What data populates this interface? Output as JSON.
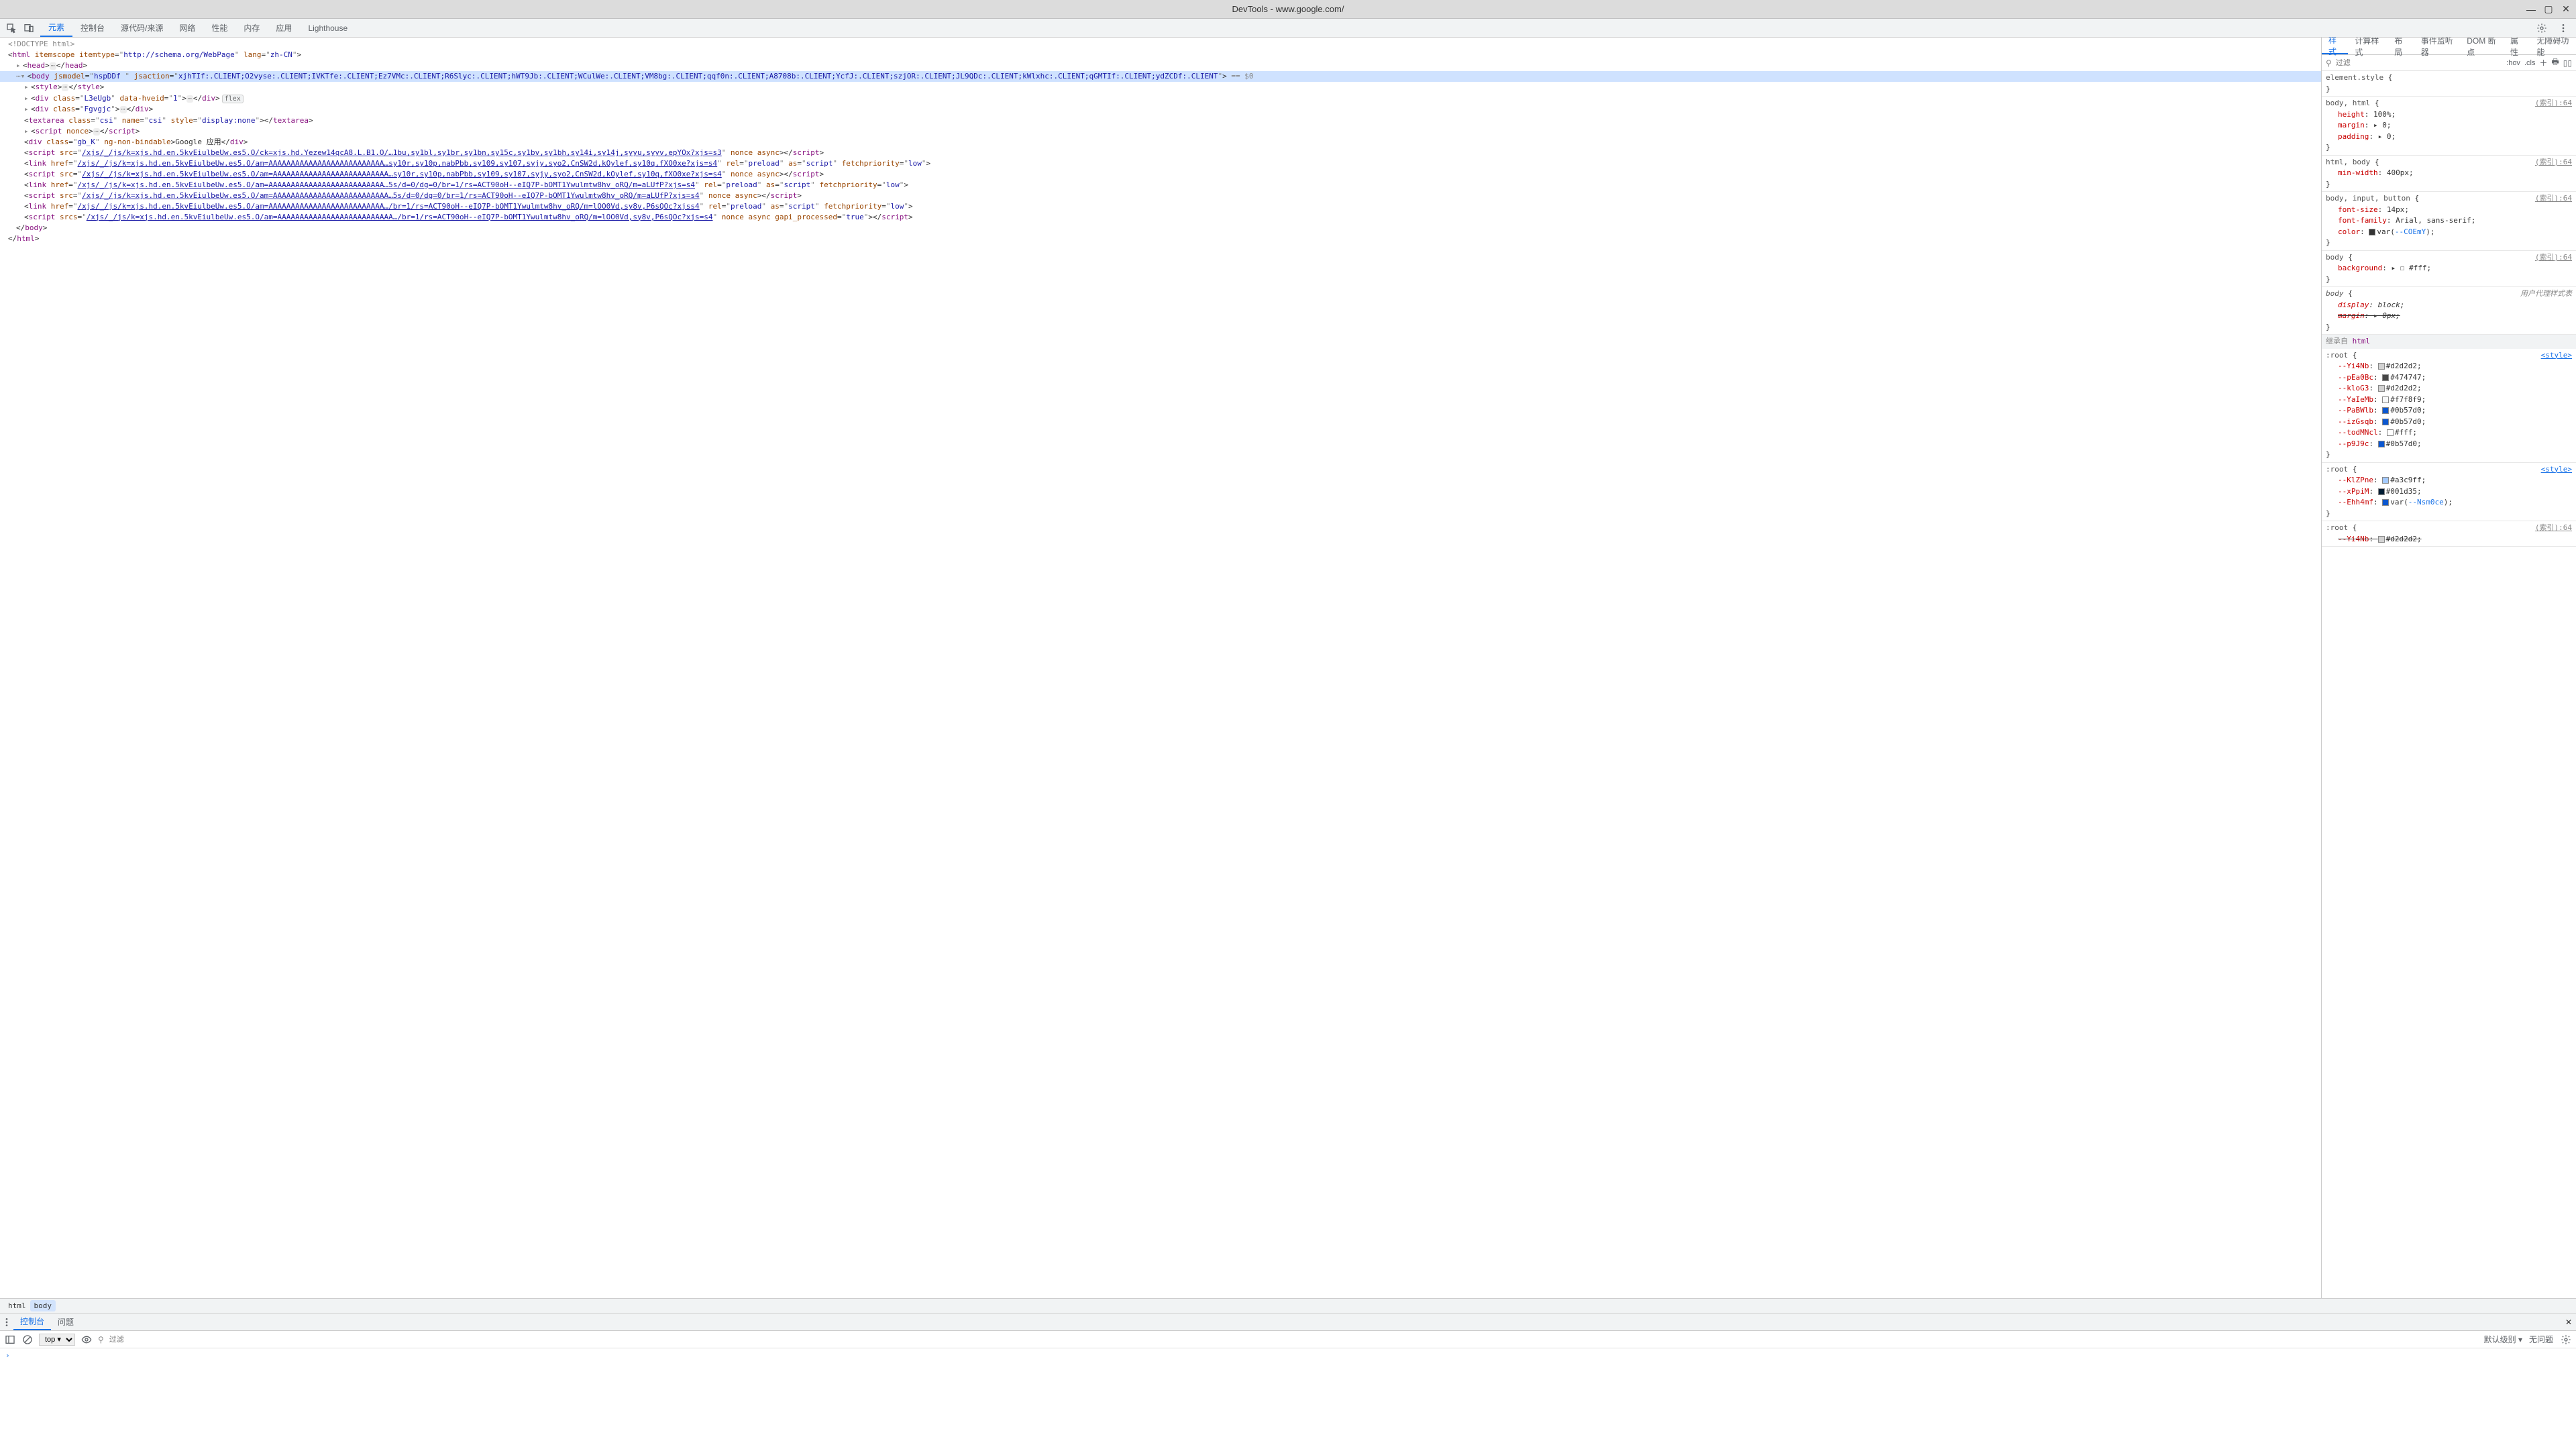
{
  "title": "DevTools - www.google.com/",
  "mainTabs": [
    "元素",
    "控制台",
    "源代码/来源",
    "网络",
    "性能",
    "内存",
    "应用",
    "Lighthouse"
  ],
  "mainActiveTab": "元素",
  "stylesTabs": [
    "样式",
    "计算样式",
    "布局",
    "事件监听器",
    "DOM 断点",
    "属性",
    "无障碍功能"
  ],
  "stylesActiveTab": "样式",
  "filterPlaceholder": "过滤",
  "hovLabel": ":hov",
  "clsLabel": ".cls",
  "breadcrumbs": [
    "html",
    "body"
  ],
  "drawerTabs": [
    "控制台",
    "问题"
  ],
  "drawerActiveTab": "控制台",
  "drawerContext": "top ▾",
  "drawerFilterPlaceholder": "过滤",
  "drawerLevel": "默认级别 ▾",
  "drawerIssues": "无问题",
  "dom": {
    "doctype": "<!DOCTYPE html>",
    "htmlOpen": {
      "itemtype": "http://schema.org/WebPage",
      "lang": "zh-CN"
    },
    "head": "<head>…</head>",
    "body": {
      "jsmodel": "hspDDf ",
      "jsaction": "xjhTIf:.CLIENT;O2vyse:.CLIENT;IVKTfe:.CLIENT;Ez7VMc:.CLIENT;R6Slyc:.CLIENT;hWT9Jb:.CLIENT;WCulWe:.CLIENT;VM8bg:.CLIENT;qqf0n:.CLIENT;A8708b:.CLIENT;YcfJ:.CLIENT;szjOR:.CLIENT;JL9QDc:.CLIENT;kWlxhc:.CLIENT;qGMTIf:.CLIENT;ydZCDf:.CLIENT",
      "comment": "== $0"
    },
    "style": "<style>…</style>",
    "div1Class": "L3eUgb",
    "div1Hveid": "1",
    "div2Class": "Fgvgjc",
    "textarea": {
      "class": "csi",
      "name": "csi",
      "style": "display:none"
    },
    "scriptNonce": "<script nonce>…</script>",
    "divGbk": {
      "class": "gb_K",
      "text": "Google 应用"
    },
    "scriptSrc1": "/xjs/_/js/k=xjs.hd.en.5kvEiulbeUw.es5.O/ck=xjs.hd.Yezew14qcA8.L.B1.O/…1bu,sy1bl,sy1br,sy1bn,sy15c,sy1bv,sy1bh,sy14i,sy14j,syyu,syyv,epYOx?xjs=s3",
    "linkHref1": "/xjs/_/js/k=xjs.hd.en.5kvEiulbeUw.es5.O/am=AAAAAAAAAAAAAAAAAAAAAAAAAA…sy10r,sy10p,nabPbb,sy109,sy107,syjy,syo2,CnSW2d,kOylef,sy10q,fXO0xe?xjs=s4",
    "scriptSrc2": "/xjs/_/js/k=xjs.hd.en.5kvEiulbeUw.es5.O/am=AAAAAAAAAAAAAAAAAAAAAAAAAA…sy10r,sy10p,nabPbb,sy109,sy107,syjy,syo2,CnSW2d,kOylef,sy10q,fXO0xe?xjs=s4",
    "linkHref2": "/xjs/_/js/k=xjs.hd.en.5kvEiulbeUw.es5.O/am=AAAAAAAAAAAAAAAAAAAAAAAAAA…5s/d=0/dg=0/br=1/rs=ACT90oH--eIQ7P-bOMT1Ywulmtw8hv_oRQ/m=aLUfP?xjs=s4",
    "scriptSrc3": "/xjs/_/js/k=xjs.hd.en.5kvEiulbeUw.es5.O/am=AAAAAAAAAAAAAAAAAAAAAAAAAA…5s/d=0/dg=0/br=1/rs=ACT90oH--eIQ7P-bOMT1Ywulmtw8hv_oRQ/m=aLUfP?xjs=s4",
    "linkHref3": "/xjs/_/js/k=xjs.hd.en.5kvEiulbeUw.es5.O/am=AAAAAAAAAAAAAAAAAAAAAAAAAA…/br=1/rs=ACT90oH--eIQ7P-bOMT1Ywulmtw8hv_oRQ/m=lOO0Vd,sy8v,P6sQOc?xjss4",
    "scriptSrcs": "/xjs/_/js/k=xjs.hd.en.5kvEiulbeUw.es5.O/am=AAAAAAAAAAAAAAAAAAAAAAAAAA…/br=1/rs=ACT90oH--eIQ7P-bOMT1Ywulmtw8hv_oRQ/m=lOO0Vd,sy8v,P6sQOc?xjs=s4",
    "linkRel": "preload",
    "linkAs": "script",
    "linkPriority": "low",
    "gapiTrue": "true"
  },
  "stylesRules": {
    "elementStyle": "element.style",
    "rule1": {
      "selector": "body, html",
      "origin": "(索引):64",
      "props": [
        [
          "height",
          "100%"
        ],
        [
          "margin",
          "▸ 0"
        ],
        [
          "padding",
          "▸ 0"
        ]
      ]
    },
    "rule2": {
      "selector": "html, body",
      "origin": "(索引):64",
      "props": [
        [
          "min-width",
          "400px"
        ]
      ]
    },
    "rule3": {
      "selector": "body, input, button",
      "origin": "(索引):64",
      "props": [
        [
          "font-size",
          "14px"
        ],
        [
          "font-family",
          "Arial, sans-serif"
        ],
        [
          "color",
          "▪ var(--COEmY)"
        ]
      ]
    },
    "rule4": {
      "selector": "body",
      "origin": "(索引):64",
      "props": [
        [
          "background",
          "▸ ☐ #fff"
        ]
      ]
    },
    "rule5": {
      "selector": "body",
      "origin": "用户代理样式表",
      "props": [
        [
          "display",
          "block"
        ],
        [
          "margin",
          "▸ 0px",
          true
        ]
      ]
    },
    "inheritFrom": "继承自 ",
    "inheritTag": "html",
    "root1": {
      "selector": ":root",
      "origin": "<style>",
      "props": [
        [
          "--Yi4Nb",
          "#d2d2d2",
          "#d2d2d2"
        ],
        [
          "--pEa0Bc",
          "#474747",
          "#474747"
        ],
        [
          "--kloG3",
          "#d2d2d2",
          "#d2d2d2"
        ],
        [
          "--YaIeMb",
          "#f7f8f9",
          "#f7f8f9"
        ],
        [
          "--PaBWlb",
          "#0b57d0",
          "#0b57d0"
        ],
        [
          "--izGsqb",
          "#0b57d0",
          "#0b57d0"
        ],
        [
          "--todMNcl",
          "#fff",
          "#fff"
        ],
        [
          "--p9J9c",
          "#0b57d0",
          "#0b57d0"
        ]
      ]
    },
    "root2": {
      "selector": ":root",
      "origin": "<style>",
      "props": [
        [
          "--KlZPne",
          "#a3c9ff",
          "#a3c9ff"
        ],
        [
          "--xPpiM",
          "#001d35",
          "#001d35"
        ],
        [
          "--Ehh4mf",
          "var(--Nsm0ce)",
          "#0b57d0"
        ]
      ]
    },
    "root3": {
      "selector": ":root",
      "origin": "(索引):64",
      "props": [
        [
          "--Yi4Nb",
          "#d2d2d2",
          "#d2d2d2",
          true
        ]
      ]
    }
  }
}
